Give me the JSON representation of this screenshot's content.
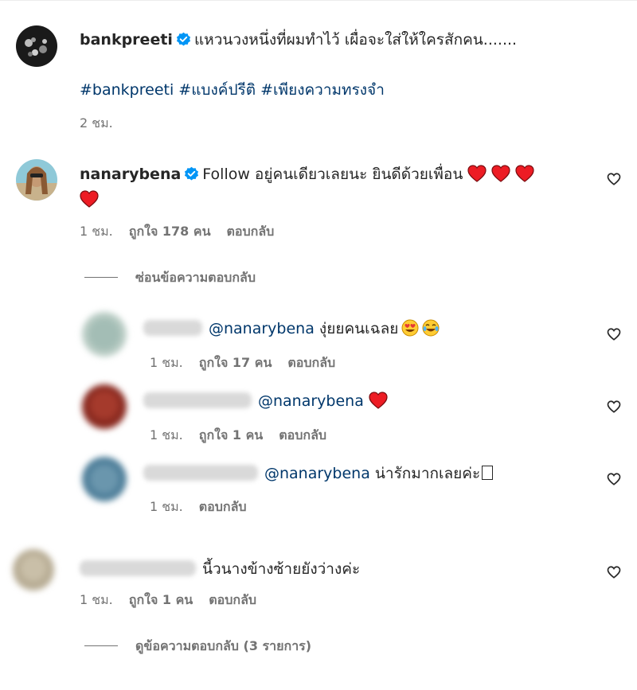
{
  "post": {
    "username": "bankpreeti",
    "caption": "แหวนวงหนึ่งที่ผมทำไว้ เผื่อจะใส่ให้ใครสักคน.......",
    "hashtags": "#bankpreeti #แบงค์ปรีติ #เพียงความทรงจำ",
    "time": "2 ชม."
  },
  "comments": [
    {
      "username": "nanarybena",
      "text_line1": "Follow อยู่คนเดียวเลยนะ ยินดีด้วยเพื่อน",
      "time": "1 ชม.",
      "likes": "ถูกใจ 178 คน",
      "reply_label": "ตอบกลับ",
      "hide_replies_label": "ซ่อนข้อความตอบกลับ",
      "replies": [
        {
          "mention": "@nanarybena",
          "text": "งุ่ยยคนเฉลย",
          "time": "1 ชม.",
          "likes": "ถูกใจ 17 คน",
          "reply_label": "ตอบกลับ"
        },
        {
          "mention": "@nanarybena",
          "text": "",
          "time": "1 ชม.",
          "likes": "ถูกใจ 1 คน",
          "reply_label": "ตอบกลับ"
        },
        {
          "mention": "@nanarybena",
          "text": "น่ารักมากเลยค่ะ",
          "time": "1 ชม.",
          "likes": "",
          "reply_label": "ตอบกลับ"
        }
      ]
    },
    {
      "text": "นี้วนางข้างซ้ายยังว่างค่ะ",
      "time": "1 ชม.",
      "likes": "ถูกใจ 1 คน",
      "reply_label": "ตอบกลับ",
      "view_replies_label": "ดูข้อความตอบกลับ (3 รายการ)"
    }
  ],
  "colors": {
    "verified": "#0095f6",
    "link": "#00376b",
    "secondary_text": "#737373",
    "heart": "#ed1c24"
  },
  "icons": {
    "verified": "verified-badge-icon",
    "like": "heart-outline-icon",
    "emoji_heart": "red-heart-emoji",
    "emoji_heart_eyes": "heart-eyes-emoji",
    "emoji_laugh": "tears-of-joy-emoji"
  }
}
